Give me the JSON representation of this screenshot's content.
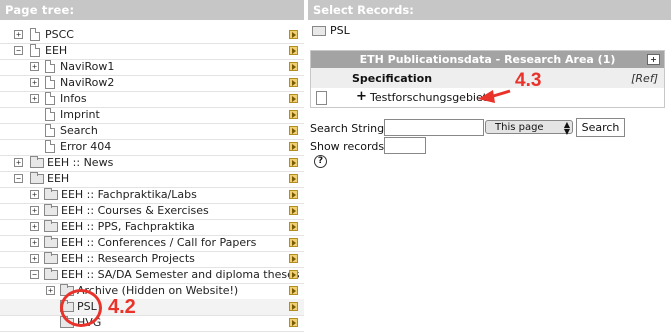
{
  "left": {
    "header": "Page tree:",
    "rows": [
      {
        "label": "PSCC"
      },
      {
        "label": "EEH"
      },
      {
        "label": "NaviRow1"
      },
      {
        "label": "NaviRow2"
      },
      {
        "label": "Infos"
      },
      {
        "label": "Imprint"
      },
      {
        "label": "Search"
      },
      {
        "label": "Error 404"
      },
      {
        "label": "EEH :: News"
      },
      {
        "label": "EEH"
      },
      {
        "label": "EEH :: Fachpraktika/Labs"
      },
      {
        "label": "EEH :: Courses & Exercises"
      },
      {
        "label": "EEH :: PPS, Fachpraktika"
      },
      {
        "label": "EEH :: Conferences / Call for Papers"
      },
      {
        "label": "EEH :: Research Projects"
      },
      {
        "label": "EEH :: SA/DA Semester and diploma theses"
      },
      {
        "label": "Archive (Hidden on Website!)"
      },
      {
        "label": "PSL"
      },
      {
        "label": "HVG"
      }
    ],
    "annotation": "4.2"
  },
  "right": {
    "header": "Select Records:",
    "current_page": "PSL",
    "table": {
      "title": "ETH Publicationsdata - Research Area (1)",
      "column": "Specification",
      "ref_label": "[Ref]",
      "record": "Testforschungsgebiet"
    },
    "annotation": "4.3",
    "search": {
      "label": "Search String:",
      "value": "",
      "scope": "This page",
      "button": "Search"
    },
    "show": {
      "label": "Show records:",
      "value": ""
    },
    "help": "?"
  },
  "colors": {
    "header_bg": "#c6c6c6",
    "table_head_bg": "#a3a3a3",
    "annotation_red": "#e8322a"
  }
}
